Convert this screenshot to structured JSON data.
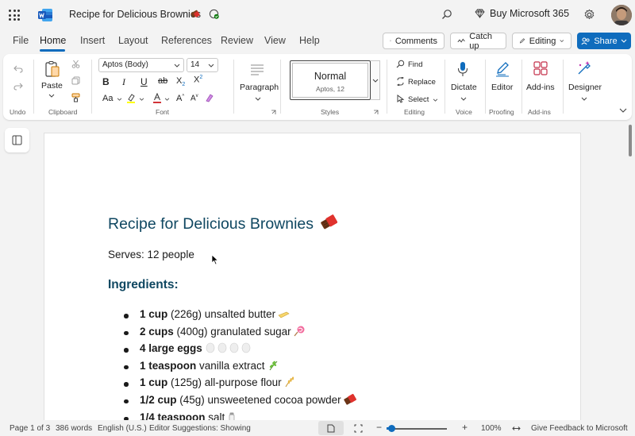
{
  "app": {
    "doc_title": "Recipe for Delicious Brownies",
    "buy_label": "Buy Microsoft 365"
  },
  "menu": {
    "file": "File",
    "home": "Home",
    "insert": "Insert",
    "layout": "Layout",
    "references": "References",
    "review": "Review",
    "view": "View",
    "help": "Help",
    "comments": "Comments",
    "catch_up": "Catch up",
    "editing": "Editing",
    "share": "Share"
  },
  "ribbon": {
    "undo_group": "Undo",
    "paste": "Paste",
    "clipboard_group": "Clipboard",
    "font_name": "Aptos (Body)",
    "font_size": "14",
    "font_group": "Font",
    "paragraph": "Paragraph",
    "style_name": "Normal",
    "style_sub": "Aptos, 12",
    "styles_group": "Styles",
    "find": "Find",
    "replace": "Replace",
    "select": "Select",
    "editing_group": "Editing",
    "dictate": "Dictate",
    "voice_group": "Voice",
    "editor": "Editor",
    "proofing_group": "Proofing",
    "addins": "Add-ins",
    "addins_group": "Add-ins",
    "designer": "Designer"
  },
  "document": {
    "title": "Recipe for Delicious Brownies",
    "serves": "Serves: 12 people",
    "ingredients_heading": "Ingredients:",
    "ingredients": [
      {
        "qty": "1 cup",
        "rest": " (226g) unsalted butter",
        "emoji": "butter"
      },
      {
        "qty": "2 cups",
        "rest": " (400g) granulated sugar",
        "emoji": "lollipop"
      },
      {
        "qty": "4 large eggs",
        "rest": "",
        "emoji": "eggs"
      },
      {
        "qty": "1 teaspoon",
        "rest": " vanilla extract",
        "emoji": "herb"
      },
      {
        "qty": "1 cup",
        "rest": " (125g) all-purpose flour",
        "emoji": "wheat"
      },
      {
        "qty": "1/2 cup",
        "rest": " (45g) unsweetened cocoa powder",
        "emoji": "chocolate"
      },
      {
        "qty": "1/4 teaspoon",
        "rest": " salt",
        "emoji": "salt"
      }
    ]
  },
  "status": {
    "page": "Page 1 of 3",
    "words": "386 words",
    "language": "English (U.S.)",
    "editor": "Editor Suggestions: Showing",
    "zoom": "100%",
    "feedback": "Give Feedback to Microsoft"
  },
  "colors": {
    "accent": "#0f6cbd",
    "heading": "#0f4761"
  }
}
